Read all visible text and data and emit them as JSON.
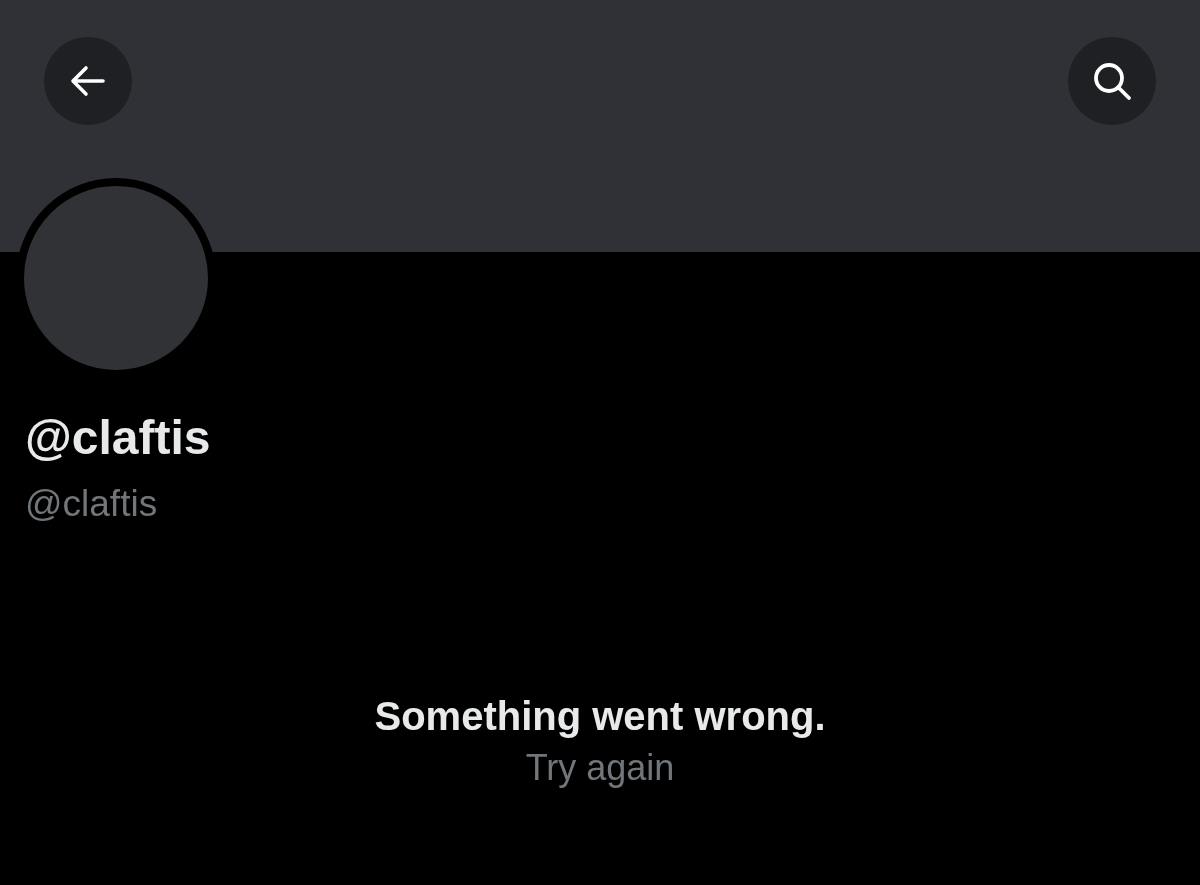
{
  "profile": {
    "display_name": "@claftis",
    "handle": "@claftis"
  },
  "error": {
    "message": "Something went wrong.",
    "retry": "Try again"
  }
}
